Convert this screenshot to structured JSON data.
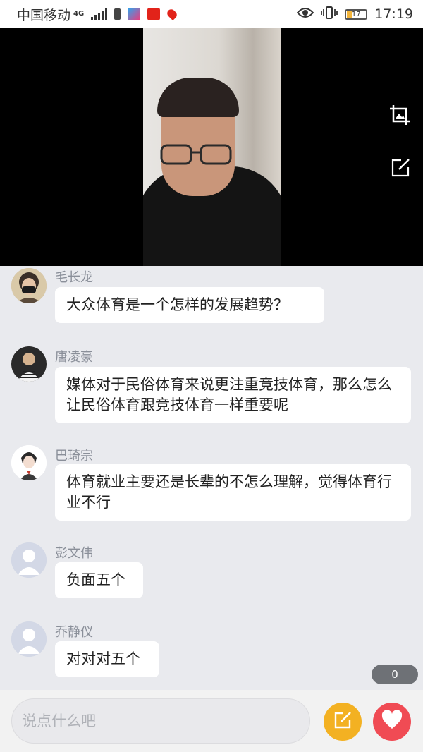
{
  "status_bar": {
    "carrier": "中国移动",
    "network": "4G",
    "battery": "17",
    "time": "17:19"
  },
  "comments": [
    {
      "username": "毛长龙",
      "text": "大众体育是一个怎样的发展趋势？",
      "avatar": "photo-masked"
    },
    {
      "username": "唐凌豪",
      "text": "媒体对于民俗体育来说更注重竞技体育，那么怎么让民俗体育跟竞技体育一样重要呢",
      "avatar": "photo-person"
    },
    {
      "username": "巴琦宗",
      "text": "体育就业主要还是长辈的不怎么理解，觉得体育行业不行",
      "avatar": "cartoon"
    },
    {
      "username": "彭文伟",
      "text": "负面五个",
      "avatar": "default"
    },
    {
      "username": "乔静仪",
      "text": "对对对五个",
      "avatar": "default"
    }
  ],
  "counter": "0",
  "input": {
    "placeholder": "说点什么吧"
  },
  "icons": {
    "video": [
      "crop-image-icon",
      "edit-icon"
    ],
    "bottom": [
      "edit-icon",
      "heart-icon"
    ]
  },
  "colors": {
    "edit_button": "#f3b122",
    "like_button": "#f04b54",
    "chat_background": "#e9eaee"
  }
}
